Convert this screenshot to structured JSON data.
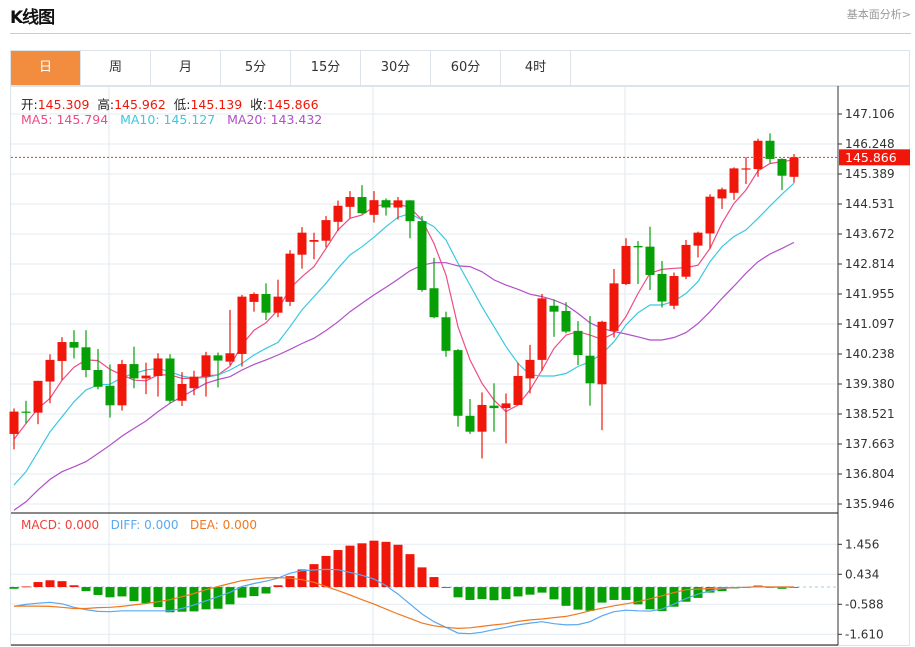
{
  "header": {
    "title": "K线图",
    "link": "基本面分析>"
  },
  "tabs": [
    "日",
    "周",
    "月",
    "5分",
    "15分",
    "30分",
    "60分",
    "4时"
  ],
  "active_tab": 0,
  "ohlc_info": {
    "open_label": "开:",
    "open": "145.309",
    "high_label": "高:",
    "high": "145.962",
    "low_label": "低:",
    "low": "145.139",
    "close_label": "收:",
    "close": "145.866"
  },
  "ma_info": {
    "ma5": "MA5: 145.794",
    "ma10": "MA10: 145.127",
    "ma20": "MA20: 143.432"
  },
  "macd_info": {
    "macd": "MACD: 0.000",
    "diff": "DIFF: 0.000",
    "dea": "DEA: 0.000"
  },
  "colors": {
    "up": "#f0160a",
    "down": "#06a006",
    "ma5": "#ee4c84",
    "ma10": "#3cc8e0",
    "ma20": "#b150c8",
    "diff": "#5aa8f0",
    "dea": "#f07820",
    "active_tab": "#f28c3e"
  },
  "chart_data": [
    {
      "type": "candlestick",
      "y_ticks": [
        "147.106",
        "146.248",
        "145.389",
        "144.531",
        "143.672",
        "142.814",
        "141.955",
        "141.097",
        "140.238",
        "139.380",
        "138.521",
        "137.663",
        "136.804",
        "135.946"
      ],
      "ylim": [
        135.946,
        147.106
      ],
      "last_price": "145.866",
      "grid": true,
      "candles": [
        [
          137.95,
          138.68,
          137.51,
          138.59
        ],
        [
          138.59,
          138.9,
          138.25,
          138.56
        ],
        [
          138.56,
          139.47,
          138.23,
          139.47
        ],
        [
          139.45,
          140.23,
          138.83,
          140.07
        ],
        [
          140.04,
          140.72,
          139.49,
          140.58
        ],
        [
          140.58,
          140.92,
          140.11,
          140.42
        ],
        [
          140.43,
          140.92,
          139.57,
          139.78
        ],
        [
          139.78,
          140.38,
          139.23,
          139.3
        ],
        [
          139.33,
          139.94,
          138.42,
          138.77
        ],
        [
          138.77,
          140.07,
          138.62,
          139.95
        ],
        [
          139.95,
          140.45,
          139.26,
          139.54
        ],
        [
          139.54,
          139.99,
          139.09,
          139.62
        ],
        [
          139.61,
          140.26,
          139.02,
          140.11
        ],
        [
          140.11,
          140.23,
          138.83,
          138.9
        ],
        [
          138.9,
          139.72,
          138.75,
          139.38
        ],
        [
          139.26,
          139.76,
          139.06,
          139.59
        ],
        [
          139.59,
          140.3,
          139.02,
          140.2
        ],
        [
          140.2,
          140.28,
          139.28,
          140.05
        ],
        [
          140.02,
          141.5,
          139.92,
          140.26
        ],
        [
          140.24,
          141.93,
          139.88,
          141.88
        ],
        [
          141.73,
          142.0,
          141.45,
          141.955
        ],
        [
          141.955,
          142.26,
          141.21,
          141.42
        ],
        [
          141.42,
          142.365,
          141.29,
          141.88
        ],
        [
          141.73,
          143.21,
          141.61,
          143.11
        ],
        [
          143.08,
          143.87,
          142.68,
          143.71
        ],
        [
          143.45,
          143.71,
          142.95,
          143.5
        ],
        [
          143.48,
          144.19,
          143.29,
          144.07
        ],
        [
          144.02,
          144.63,
          143.76,
          144.48
        ],
        [
          144.45,
          144.9,
          144.12,
          144.73
        ],
        [
          144.73,
          145.07,
          144.24,
          144.27
        ],
        [
          144.22,
          144.9,
          144.0,
          144.64
        ],
        [
          144.64,
          144.69,
          144.2,
          144.43
        ],
        [
          144.43,
          144.73,
          144.09,
          144.635
        ],
        [
          144.635,
          144.64,
          143.55,
          144.04
        ],
        [
          144.04,
          144.19,
          142.02,
          142.07
        ],
        [
          142.12,
          142.99,
          141.26,
          141.29
        ],
        [
          141.29,
          141.45,
          140.16,
          140.33
        ],
        [
          140.35,
          140.38,
          138.16,
          138.47
        ],
        [
          138.47,
          138.95,
          137.95,
          138.015
        ],
        [
          138.015,
          139.14,
          137.25,
          138.78
        ],
        [
          138.76,
          139.4,
          138.015,
          138.69
        ],
        [
          138.69,
          139.11,
          137.68,
          138.825
        ],
        [
          138.78,
          139.99,
          138.78,
          139.61
        ],
        [
          139.54,
          140.5,
          139.11,
          140.07
        ],
        [
          140.07,
          141.955,
          139.76,
          141.83
        ],
        [
          141.62,
          141.8,
          140.73,
          141.45
        ],
        [
          141.47,
          141.72,
          140.83,
          140.88
        ],
        [
          140.9,
          141.18,
          139.92,
          140.21
        ],
        [
          140.19,
          141.325,
          138.76,
          139.4
        ],
        [
          139.37,
          141.19,
          138.06,
          141.16
        ],
        [
          140.9,
          142.67,
          140.71,
          142.26
        ],
        [
          142.24,
          143.55,
          142.21,
          143.33
        ],
        [
          143.33,
          143.47,
          142.24,
          143.29
        ],
        [
          143.31,
          143.88,
          142.07,
          142.5
        ],
        [
          142.53,
          142.9,
          141.57,
          141.74
        ],
        [
          141.62,
          142.57,
          141.52,
          142.47
        ],
        [
          142.45,
          143.5,
          142.38,
          143.36
        ],
        [
          143.34,
          143.74,
          143.0,
          143.71
        ],
        [
          143.69,
          144.81,
          143.26,
          144.74
        ],
        [
          144.69,
          145.0,
          144.39,
          144.95
        ],
        [
          144.85,
          145.58,
          144.65,
          145.55
        ],
        [
          145.53,
          145.87,
          145.1,
          145.55
        ],
        [
          145.53,
          146.4,
          145.31,
          146.34
        ],
        [
          146.34,
          146.55,
          145.69,
          145.82
        ],
        [
          145.82,
          145.84,
          144.93,
          145.34
        ],
        [
          145.309,
          145.962,
          145.139,
          145.866
        ]
      ],
      "candle_format": [
        "open",
        "high",
        "low",
        "close"
      ],
      "series": [
        {
          "name": "MA5",
          "values": [
            137.8,
            138.25,
            138.68,
            138.97,
            139.49,
            139.86,
            140.07,
            140.05,
            139.8,
            139.64,
            139.49,
            139.47,
            139.64,
            139.64,
            139.54,
            139.54,
            139.61,
            139.64,
            139.89,
            140.5,
            140.92,
            141.13,
            141.5,
            142.12,
            142.45,
            142.74,
            143.26,
            143.79,
            144.12,
            144.22,
            144.45,
            144.53,
            144.53,
            144.43,
            144.07,
            143.4,
            142.5,
            141.02,
            140.07,
            139.4,
            138.92,
            138.59,
            138.78,
            139.21,
            139.78,
            140.4,
            140.78,
            140.88,
            140.78,
            140.66,
            140.83,
            141.31,
            141.97,
            142.55,
            142.66,
            142.69,
            142.71,
            142.78,
            143.26,
            143.98,
            144.55,
            144.93,
            145.48,
            145.69,
            145.74,
            145.794
          ]
        },
        {
          "name": "MA10",
          "values": [
            136.49,
            136.87,
            137.44,
            138.01,
            138.44,
            138.87,
            139.21,
            139.35,
            139.37,
            139.57,
            139.68,
            139.78,
            139.83,
            139.73,
            139.61,
            139.54,
            139.57,
            139.64,
            139.78,
            139.97,
            140.21,
            140.4,
            140.57,
            141.02,
            141.5,
            141.88,
            142.26,
            142.69,
            143.07,
            143.31,
            143.58,
            143.88,
            144.15,
            144.26,
            144.07,
            143.88,
            143.5,
            142.83,
            142.21,
            141.59,
            141.02,
            140.45,
            139.97,
            139.64,
            139.61,
            139.61,
            139.68,
            139.88,
            140.02,
            140.24,
            140.59,
            141.07,
            141.42,
            141.64,
            141.64,
            141.75,
            141.97,
            142.31,
            142.88,
            143.31,
            143.6,
            143.79,
            144.12,
            144.47,
            144.81,
            145.127
          ]
        },
        {
          "name": "MA20",
          "values": [
            135.77,
            136.01,
            136.35,
            136.65,
            136.87,
            137.01,
            137.16,
            137.39,
            137.63,
            137.89,
            138.11,
            138.32,
            138.59,
            138.83,
            139.02,
            139.21,
            139.4,
            139.51,
            139.59,
            139.78,
            139.94,
            140.07,
            140.21,
            140.37,
            140.54,
            140.69,
            140.91,
            141.16,
            141.45,
            141.69,
            141.93,
            142.15,
            142.38,
            142.62,
            142.78,
            142.85,
            142.85,
            142.76,
            142.74,
            142.59,
            142.36,
            142.21,
            142.09,
            141.95,
            141.88,
            141.78,
            141.64,
            141.4,
            141.13,
            140.97,
            140.88,
            140.81,
            140.73,
            140.64,
            140.64,
            140.71,
            140.85,
            141.11,
            141.45,
            141.83,
            142.18,
            142.55,
            142.88,
            143.1,
            143.26,
            143.432
          ]
        }
      ]
    },
    {
      "type": "bar+line",
      "y_ticks": [
        "1.456",
        "0.434",
        "-0.588",
        "-1.610"
      ],
      "ylim": [
        -1.61,
        1.456
      ],
      "grid": true,
      "series": [
        {
          "name": "MACD",
          "values": [
            -0.06,
            0.02,
            0.17,
            0.23,
            0.2,
            0.06,
            -0.14,
            -0.27,
            -0.35,
            -0.32,
            -0.48,
            -0.55,
            -0.68,
            -0.86,
            -0.84,
            -0.83,
            -0.76,
            -0.74,
            -0.59,
            -0.36,
            -0.31,
            -0.22,
            0.06,
            0.37,
            0.6,
            0.78,
            1.06,
            1.26,
            1.41,
            1.49,
            1.58,
            1.54,
            1.44,
            1.12,
            0.67,
            0.34,
            -0.03,
            -0.35,
            -0.44,
            -0.41,
            -0.45,
            -0.41,
            -0.32,
            -0.26,
            -0.19,
            -0.42,
            -0.64,
            -0.77,
            -0.81,
            -0.53,
            -0.44,
            -0.44,
            -0.59,
            -0.76,
            -0.82,
            -0.67,
            -0.5,
            -0.37,
            -0.19,
            -0.14,
            -0.05,
            -0.02,
            0.05,
            -0.01,
            -0.06,
            0.0
          ]
        },
        {
          "name": "DIFF",
          "values": [
            -0.66,
            -0.59,
            -0.55,
            -0.52,
            -0.57,
            -0.69,
            -0.77,
            -0.83,
            -0.84,
            -0.81,
            -0.81,
            -0.81,
            -0.81,
            -0.81,
            -0.73,
            -0.61,
            -0.47,
            -0.33,
            -0.18,
            0.02,
            0.12,
            0.2,
            0.3,
            0.47,
            0.56,
            0.58,
            0.6,
            0.59,
            0.5,
            0.4,
            0.27,
            0.05,
            -0.24,
            -0.58,
            -0.92,
            -1.18,
            -1.37,
            -1.57,
            -1.59,
            -1.54,
            -1.45,
            -1.37,
            -1.29,
            -1.23,
            -1.18,
            -1.25,
            -1.29,
            -1.28,
            -1.18,
            -0.98,
            -0.84,
            -0.79,
            -0.81,
            -0.82,
            -0.75,
            -0.58,
            -0.39,
            -0.24,
            -0.14,
            -0.05,
            -0.02,
            -0.01,
            0.01,
            0.0,
            0.0,
            0.0
          ]
        },
        {
          "name": "DEA",
          "values": [
            -0.65,
            -0.65,
            -0.65,
            -0.66,
            -0.69,
            -0.73,
            -0.73,
            -0.7,
            -0.69,
            -0.66,
            -0.61,
            -0.56,
            -0.5,
            -0.43,
            -0.33,
            -0.22,
            -0.09,
            0.02,
            0.12,
            0.22,
            0.27,
            0.31,
            0.32,
            0.3,
            0.25,
            0.16,
            0.02,
            -0.12,
            -0.27,
            -0.43,
            -0.58,
            -0.75,
            -0.92,
            -1.07,
            -1.23,
            -1.32,
            -1.37,
            -1.41,
            -1.39,
            -1.34,
            -1.29,
            -1.25,
            -1.17,
            -1.12,
            -1.09,
            -1.04,
            -1.0,
            -0.91,
            -0.81,
            -0.72,
            -0.64,
            -0.57,
            -0.5,
            -0.4,
            -0.3,
            -0.19,
            -0.09,
            -0.07,
            -0.05,
            -0.03,
            -0.02,
            -0.01,
            0.01,
            0.0,
            0.0,
            0.0
          ]
        }
      ]
    }
  ]
}
